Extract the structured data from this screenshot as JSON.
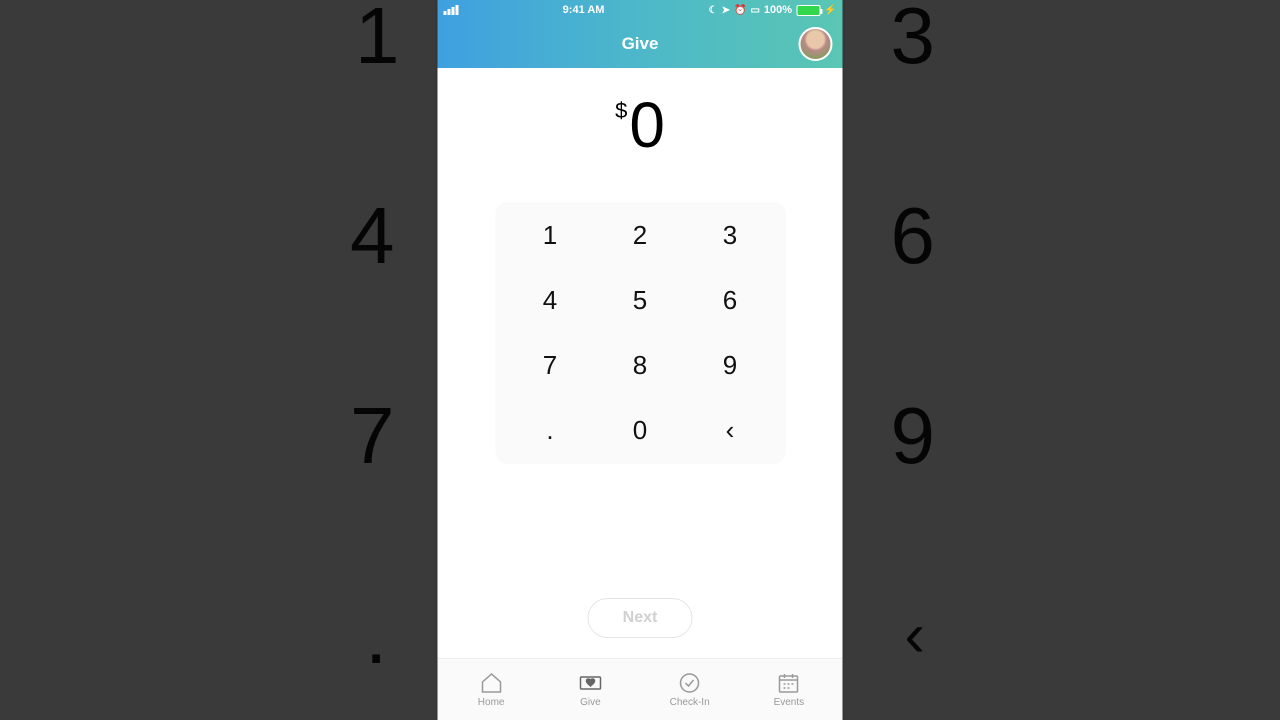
{
  "status": {
    "time": "9:41 AM",
    "battery_text": "100%"
  },
  "header": {
    "title": "Give"
  },
  "amount": {
    "currency": "$",
    "value": "0"
  },
  "keypad": {
    "k1": "1",
    "k2": "2",
    "k3": "3",
    "k4": "4",
    "k5": "5",
    "k6": "6",
    "k7": "7",
    "k8": "8",
    "k9": "9",
    "dot": ".",
    "k0": "0",
    "back": "‹"
  },
  "next_label": "Next",
  "tabs": {
    "home": "Home",
    "give": "Give",
    "checkin": "Check-In",
    "events": "Events"
  },
  "bg": {
    "n1": "1",
    "n3": "3",
    "n4": "4",
    "n6": "6",
    "n7": "7",
    "n9": "9",
    "dot": ".",
    "back": "‹"
  }
}
